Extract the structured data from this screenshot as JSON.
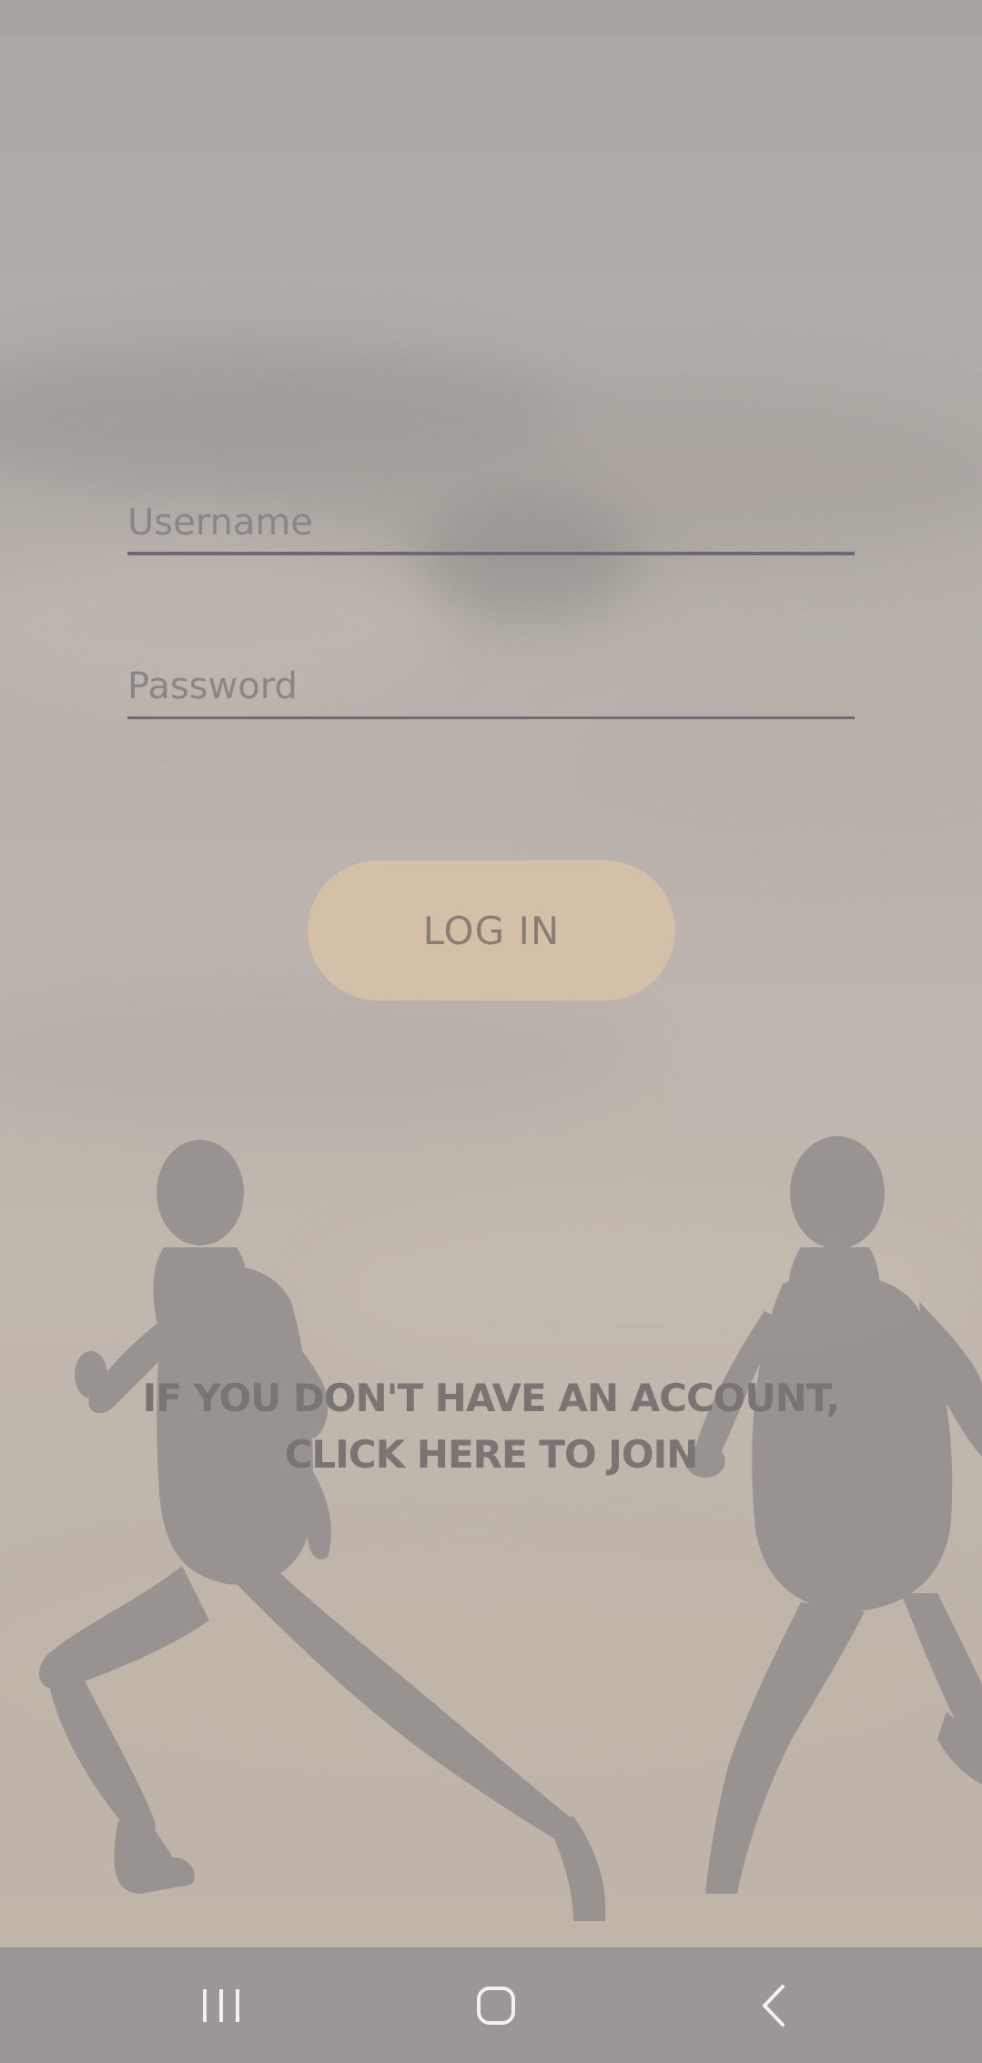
{
  "login_form": {
    "username_placeholder": "Username",
    "password_placeholder": "Password",
    "login_button_label": "LOG IN",
    "join_line_1": "IF YOU DON'T HAVE AN ACCOUNT,",
    "join_line_2": "CLICK HERE TO JOIN"
  },
  "background": {
    "description_icon": "runners-silhouette-image"
  },
  "nav_bar": {
    "recents_icon": "recents-icon",
    "home_icon": "home-icon",
    "back_icon": "back-icon"
  },
  "colors": {
    "button_bg": "#d4bfa9",
    "button_text": "#8a7e74",
    "username_underline": "#6f6678",
    "nav_bar_bg": "#9a969a"
  }
}
